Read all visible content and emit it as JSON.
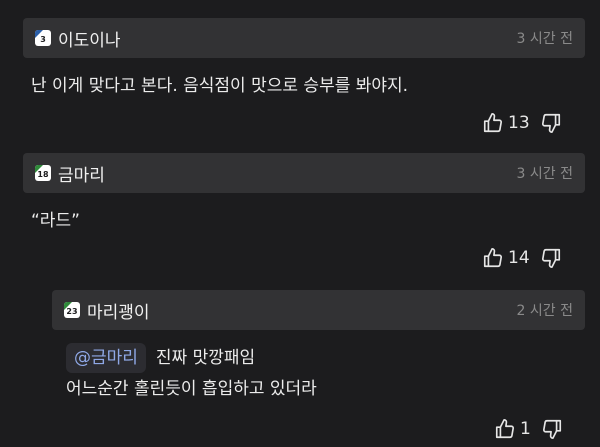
{
  "comments": [
    {
      "badge_level": "3",
      "nickname": "이도이나",
      "time": "3 시간 전",
      "text": "난 이게 맞다고 본다. 음식점이 맛으로 승부를 봐야지.",
      "likes": "13"
    },
    {
      "badge_level": "18",
      "nickname": "금마리",
      "time": "3 시간 전",
      "text": "“라드”",
      "likes": "14"
    }
  ],
  "reply": {
    "badge_level": "23",
    "nickname": "마리괭이",
    "time": "2 시간 전",
    "mention": "@금마리",
    "line1": "진짜 맛깡패임",
    "line2": "어느순간 홀린듯이 흡입하고 있더라",
    "likes": "1"
  },
  "icons": {
    "like": "thumbs-up-icon",
    "dislike": "thumbs-down-icon"
  },
  "colors": {
    "background": "#1c1c1e",
    "header": "#323234",
    "mention": "#8fa8e6",
    "badge_blue": "#2b5fa8",
    "badge_green": "#2f8a3a"
  }
}
